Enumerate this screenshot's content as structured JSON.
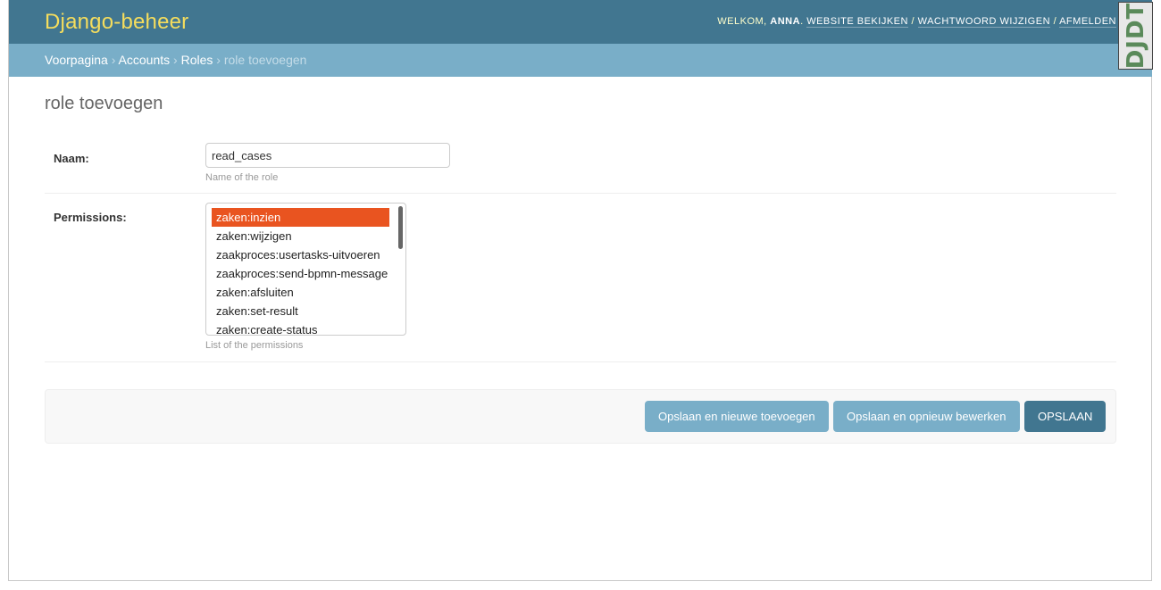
{
  "header": {
    "brand": "Django-beheer",
    "welcome": "Welkom,",
    "username": "Anna",
    "links": [
      "Website bekijken",
      "Wachtwoord wijzigen",
      "Afmelden"
    ]
  },
  "breadcrumbs": {
    "items": [
      "Voorpagina",
      "Accounts",
      "Roles"
    ],
    "current": "role toevoegen",
    "separator": "›"
  },
  "debug_toolbar": {
    "label": "DJDT"
  },
  "page": {
    "title": "role toevoegen"
  },
  "form": {
    "name": {
      "label": "Naam:",
      "value": "read_cases",
      "help": "Name of the role"
    },
    "permissions": {
      "label": "Permissions:",
      "options": [
        "zaken:inzien",
        "zaken:wijzigen",
        "zaakproces:usertasks-uitvoeren",
        "zaakproces:send-bpmn-message",
        "zaken:afsluiten",
        "zaken:set-result",
        "zaken:create-status"
      ],
      "selected": "zaken:inzien",
      "help": "List of the permissions"
    }
  },
  "actions": {
    "save_add": "Opslaan en nieuwe toevoegen",
    "save_continue": "Opslaan en opnieuw bewerken",
    "save": "Opslaan"
  },
  "colors": {
    "header": "#417690",
    "breadcrumbs": "#79aec8",
    "brand": "#f5dd5d",
    "selected_option": "#e95420"
  }
}
